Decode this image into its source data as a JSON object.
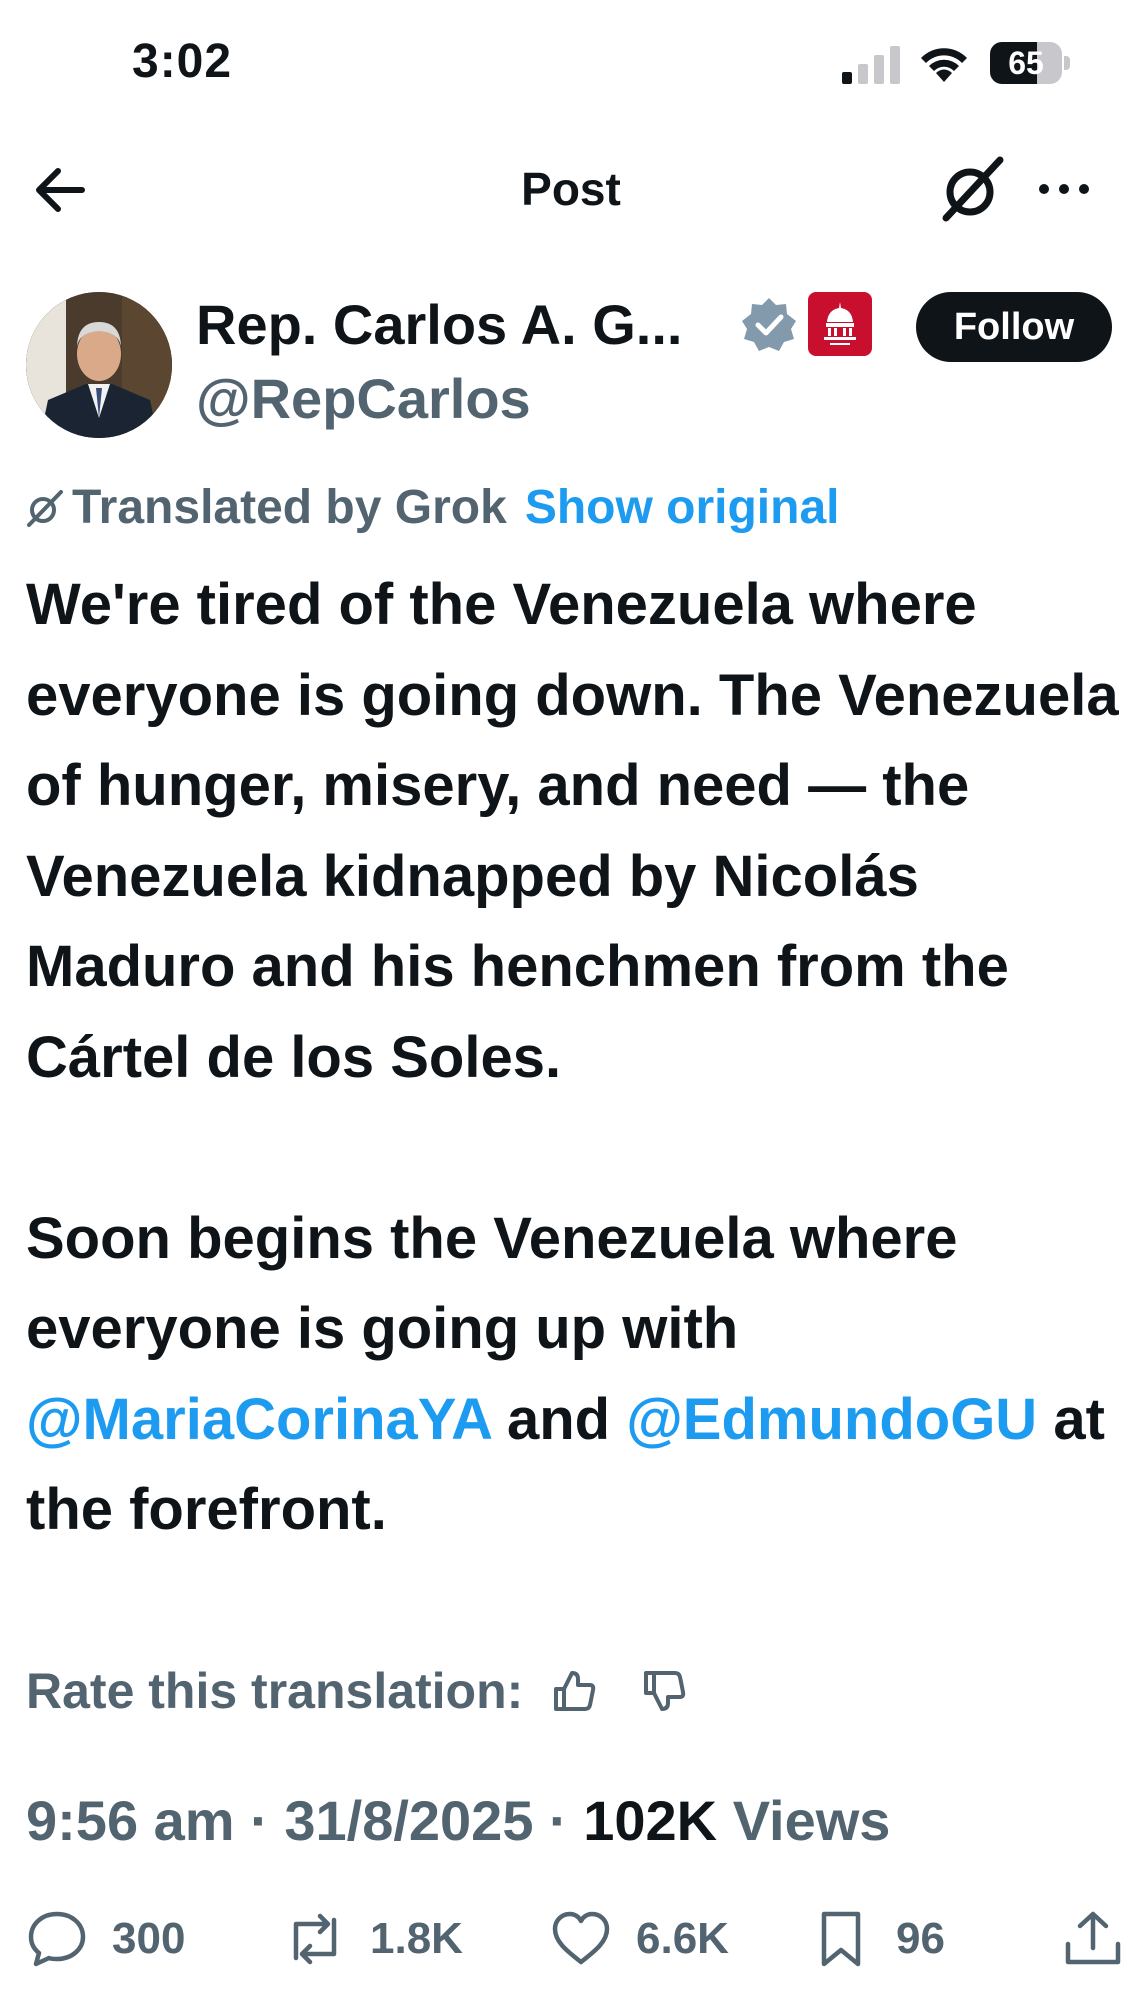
{
  "status_bar": {
    "time": "3:02",
    "battery_level": "65",
    "battery_fraction": 0.65
  },
  "nav": {
    "title": "Post"
  },
  "author": {
    "name": "Rep. Carlos A. G...",
    "handle": "@RepCarlos",
    "follow_label": "Follow"
  },
  "translation": {
    "label": "Translated by Grok",
    "show_original": "Show original",
    "rate_label": "Rate this translation:"
  },
  "tweet": {
    "p1": "We're tired of the Venezuela where everyone is going down. The Venezuela of hunger, misery, and need — the Venezuela kidnapped by Nicolás Maduro and his henchmen from the Cártel de los Soles.",
    "p2_text": "Soon begins the Venezuela where everyone is going up with",
    "mention1": "@MariaCorinaYA",
    "p2_and": "and",
    "mention2": "@EdmundoGU",
    "p2_end": "at the forefront."
  },
  "meta": {
    "time": "9:56 am",
    "date": "31/8/2025",
    "views_count": "102K",
    "views_label": "Views"
  },
  "actions": {
    "replies": "300",
    "reposts": "1.8K",
    "likes": "6.6K",
    "bookmarks": "96"
  },
  "colors": {
    "text": "#0f1419",
    "secondary": "#536471",
    "link": "#1d9bf0",
    "badge_red": "#c8102e"
  },
  "icons": [
    "signal-icon",
    "wifi-icon",
    "battery-icon",
    "back-arrow-icon",
    "grok-icon",
    "more-icon",
    "verified-icon",
    "house-gop-badge",
    "thumbs-up-icon",
    "thumbs-down-icon",
    "reply-icon",
    "repost-icon",
    "like-icon",
    "bookmark-icon",
    "share-icon"
  ]
}
